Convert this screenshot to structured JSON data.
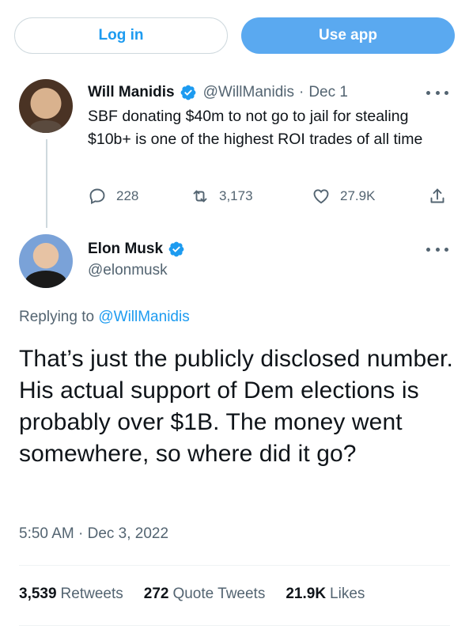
{
  "top_bar": {
    "login_label": "Log in",
    "use_app_label": "Use app"
  },
  "parent_tweet": {
    "author_name": "Will Manidis",
    "handle": "@WillManidis",
    "separator": "·",
    "date": "Dec 1",
    "text": "SBF donating $40m to not go to jail for stealing $10b+ is one of the highest ROI trades of all time",
    "replies": "228",
    "retweets": "3,173",
    "likes": "27.9K"
  },
  "reply_tweet": {
    "author_name": "Elon Musk",
    "handle": "@elonmusk",
    "replying_prefix": "Replying to",
    "replying_to": "@WillManidis",
    "text": "That’s just the publicly disclosed number. His actual support of Dem elections is probably over $1B. The money went somewhere, so where did it go?",
    "timestamp": "5:50 AM · Dec 3, 2022",
    "stats": {
      "retweets_count": "3,539",
      "retweets_label": "Retweets",
      "quotes_count": "272",
      "quotes_label": "Quote Tweets",
      "likes_count": "21.9K",
      "likes_label": "Likes"
    }
  },
  "colors": {
    "accent": "#1d9bf0",
    "use_app_button": "#5aa9f0",
    "text_primary": "#0f1419",
    "text_secondary": "#536471",
    "verified": "#1d9bf0"
  },
  "icons": [
    "verified-badge-icon",
    "more-options-icon",
    "reply-icon",
    "retweet-icon",
    "like-icon",
    "share-icon"
  ]
}
